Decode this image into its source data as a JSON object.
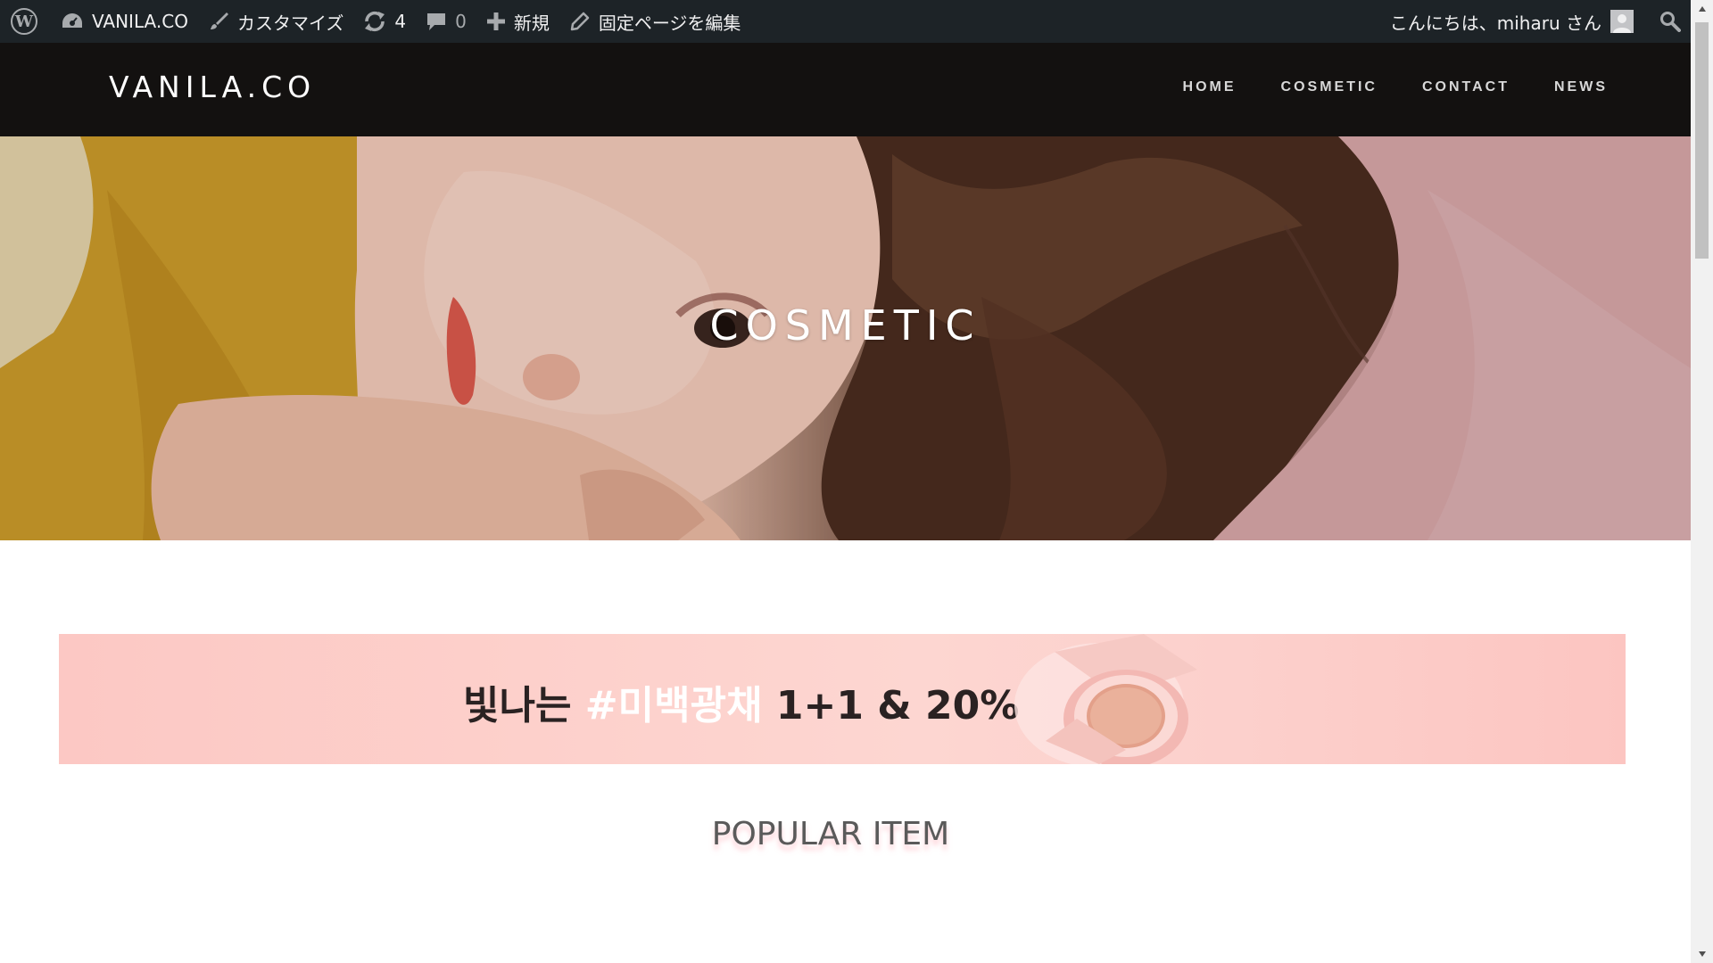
{
  "admin_bar": {
    "site_name": "VANILA.CO",
    "customize_label": "カスタマイズ",
    "updates_count": "4",
    "comments_count": "0",
    "new_label": "新規",
    "edit_label": "固定ページを編集",
    "greeting": "こんにちは、miharu さん"
  },
  "site": {
    "title": "VANILA.CO"
  },
  "nav": {
    "items": [
      {
        "label": "HOME"
      },
      {
        "label": "COSMETIC"
      },
      {
        "label": "CONTACT"
      },
      {
        "label": "NEWS"
      }
    ]
  },
  "hero": {
    "title": "COSMETIC"
  },
  "promo": {
    "text_before": "빛나는 ",
    "highlight": "#미백광채",
    "text_after": " 1+1 & 20%"
  },
  "section": {
    "heading": "POPULAR ITEM"
  },
  "colors": {
    "admin_bar_bg": "#1d2327",
    "header_bg": "#131110",
    "promo_bg": "#fdd0cb"
  }
}
